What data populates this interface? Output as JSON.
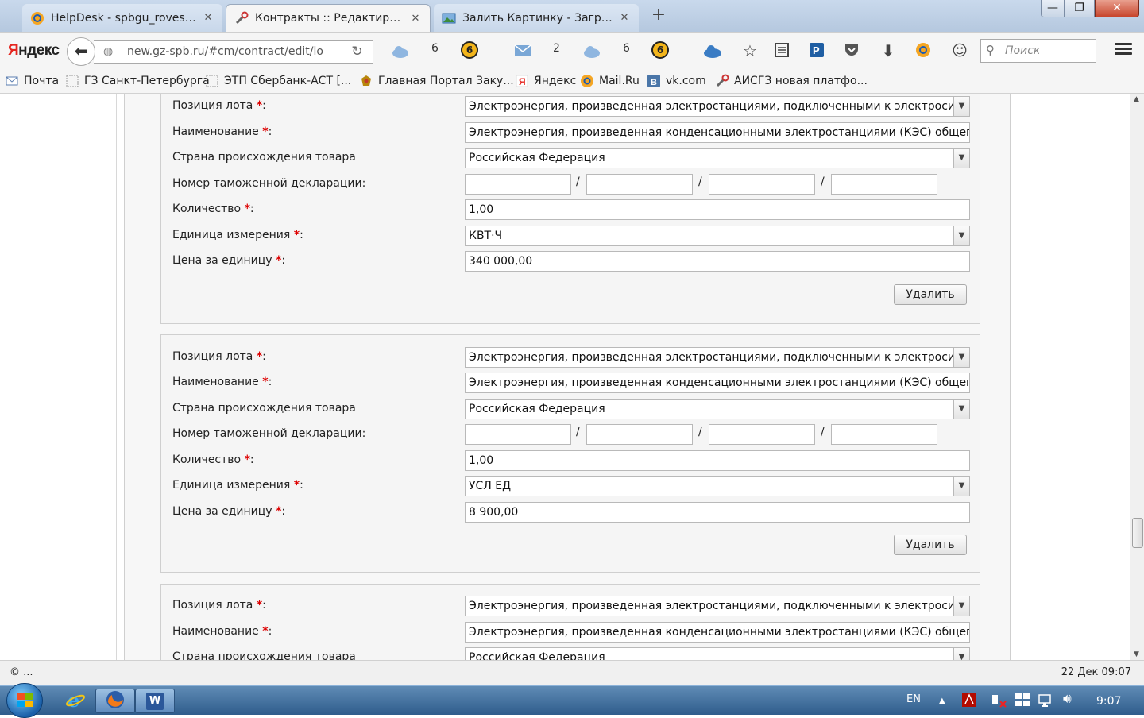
{
  "browser": {
    "tabs": [
      {
        "label": "HelpDesk - spbgu_rovesnik...",
        "icon": "mail-ru-icon",
        "active": false
      },
      {
        "label": "Контракты :: Редактирова...",
        "icon": "tools-icon",
        "active": true
      },
      {
        "label": "Залить Картинку - Загруз...",
        "icon": "image-icon",
        "active": false
      }
    ],
    "close_glyph": "✕",
    "new_tab_glyph": "+",
    "window_buttons": {
      "minimize": "—",
      "maximize": "❐",
      "close": "✕"
    }
  },
  "nav": {
    "logo_first": "Я",
    "logo_rest": "ндекс",
    "url": "new.gz-spb.ru/#cm/contract/edit/lo",
    "count_cloud1": "6",
    "coin1": "6",
    "count_mail": "2",
    "count_cloud2": "6",
    "coin2": "6",
    "search_placeholder": "Поиск"
  },
  "bookmarks": [
    {
      "label": "Почта",
      "icon": "mail-icon"
    },
    {
      "label": "ГЗ Санкт-Петербурга",
      "icon": "page-icon"
    },
    {
      "label": "ЭТП Сбербанк-АСТ [...",
      "icon": "page-icon"
    },
    {
      "label": "Главная Портал Заку...",
      "icon": "emblem-icon"
    },
    {
      "label": "Яндекс",
      "icon": "yandex-icon"
    },
    {
      "label": "Mail.Ru",
      "icon": "mail-ru-icon"
    },
    {
      "label": "vk.com",
      "icon": "vk-icon"
    },
    {
      "label": "АИСГЗ новая платфо...",
      "icon": "tools-icon"
    }
  ],
  "form_labels": {
    "lot_position": "Позиция лота",
    "name": "Наименование",
    "country": "Страна происхождения товара",
    "customs_decl": "Номер таможенной декларации:",
    "quantity": "Количество",
    "unit": "Единица измерения",
    "price": "Цена за единицу",
    "required_mark": "*",
    "colon": ":",
    "slash": "/",
    "delete_button": "Удалить"
  },
  "lots": [
    {
      "lot_position": "Электроэнергия, произведенная электростанциями, подключенными к электросистеме общего назначения",
      "name": "Электроэнергия, произведенная конденсационными электростанциями (КЭС) общего назначения",
      "country": "Российская Федерация",
      "quantity": "1,00",
      "unit": "КВТ·Ч",
      "price": "340 000,00"
    },
    {
      "lot_position": "Электроэнергия, произведенная электростанциями, подключенными к электросистеме общего назначения",
      "name": "Электроэнергия, произведенная конденсационными электростанциями (КЭС) общего назначения",
      "country": "Российская Федерация",
      "quantity": "1,00",
      "unit": "УСЛ ЕД",
      "price": "8 900,00"
    },
    {
      "lot_position": "Электроэнергия, произведенная электростанциями, подключенными к электросистеме общего назначения",
      "name": "Электроэнергия, произведенная конденсационными электростанциями (КЭС) общего назначения",
      "country": "Российская Федерация"
    }
  ],
  "status": {
    "left": "© ...",
    "right": "22 Дек 09:07"
  },
  "taskbar": {
    "lang": "EN",
    "time": "9:07",
    "word_label": "W"
  }
}
